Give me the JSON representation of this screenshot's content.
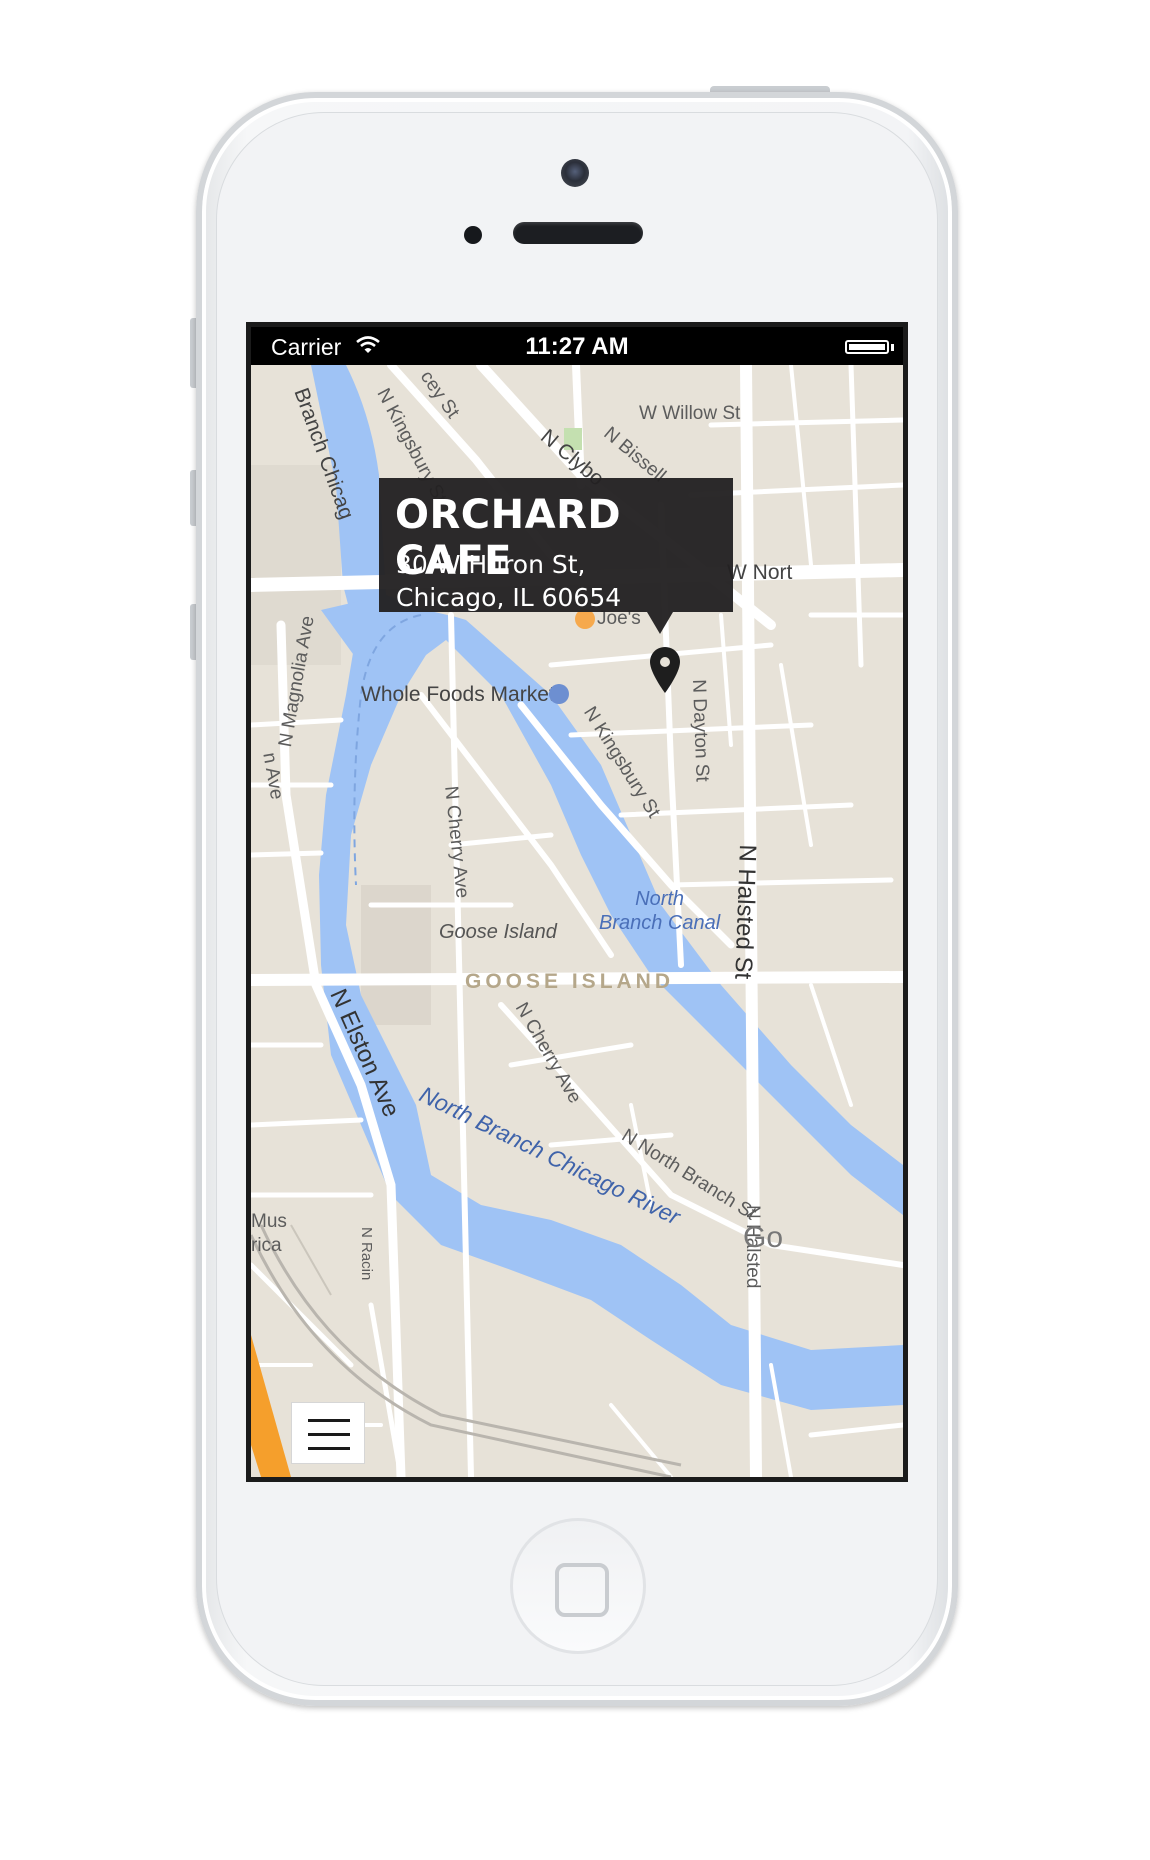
{
  "status_bar": {
    "carrier": "Carrier",
    "time": "11:27 AM",
    "wifi_icon": "wifi-icon",
    "battery_icon": "battery-icon"
  },
  "callout": {
    "title": "ORCHARD CAFE",
    "address_line1": "30 W Huron St,",
    "address_line2": "Chicago, IL 60654"
  },
  "map": {
    "labels": {
      "north_branch_chicago_top": "Branch Chicag",
      "n_kingsbury_top": "N Kingsbury St",
      "cey_st": "cey St",
      "n_clybourn": "N Clybo",
      "n_bissell": "N Bissell",
      "w_willow": "W Willow St",
      "w_north": "W Nort",
      "joes": "Joe's",
      "n_magnolia": "N Magnolia Ave",
      "ave_left": "n Ave",
      "whole_foods": "Whole Foods Market",
      "n_kingsbury_mid": "N Kingsbury St",
      "n_dayton": "N Dayton St",
      "n_cherry_upper": "N Cherry Ave",
      "n_halsted": "N Halsted St",
      "north_branch_canal": "North\nBranch Canal",
      "goose_island_italic": "Goose Island",
      "goose_island_area": "GOOSE ISLAND",
      "n_elston": "N Elston Ave",
      "n_cherry_lower": "N Cherry Ave",
      "north_branch_river": "North Branch Chicago River",
      "n_north_branch": "N North Branch St",
      "n_halsted_lower": "N Halsted",
      "n_racine": "N Racin",
      "museum": "Mus",
      "museum2": "rica",
      "google_logo": "Go"
    },
    "colors": {
      "land": "#e7e2d8",
      "road": "#ffffff",
      "water": "#9fc3f5",
      "highway": "#f59f2c"
    }
  },
  "menu_button": {
    "icon": "hamburger-menu-icon"
  },
  "pin_icon": "map-pin-icon"
}
